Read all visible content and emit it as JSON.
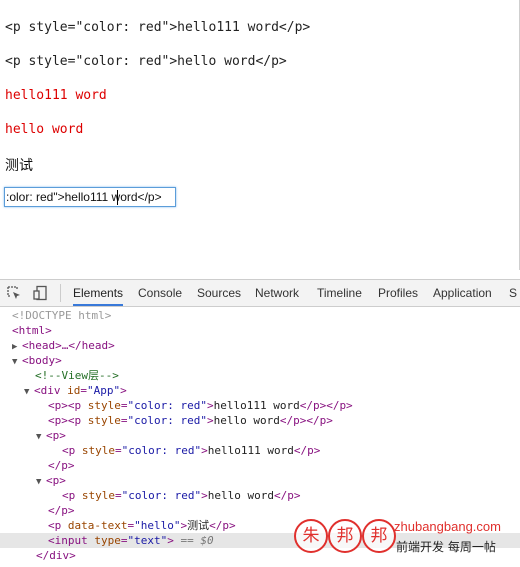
{
  "page": {
    "line1": "<p style=\"color: red\">hello111 word</p>",
    "line2": "<p style=\"color: red\">hello word</p>",
    "red1": "hello111 word",
    "red2": "hello word",
    "cn": "测试",
    "input_value": ":olor: red\">hello111 word</p>",
    "red_color": "#dd0000"
  },
  "devtools": {
    "tabs": [
      "Elements",
      "Console",
      "Sources",
      "Network",
      "Timeline",
      "Profiles",
      "Application",
      "S"
    ],
    "active_tab": "Elements",
    "icons": [
      "inspect-icon",
      "device-mode-icon"
    ],
    "tree": {
      "doctype": "<!DOCTYPE html>",
      "html_open": "<html>",
      "head": "<head>…</head>",
      "body_open": "<body>",
      "comment": "<!--View层-->",
      "div_open_tag": "<div",
      "div_attr": "id",
      "div_val": "\"App\"",
      "div_close_bracket": ">",
      "p1_open": "<p>",
      "p1_inner_tag": "<p",
      "style_attr": "style",
      "style_val": "\"color: red\"",
      "p1_text": "hello111 word",
      "p_close_pair": "</p></p>",
      "p2_text": "hello word",
      "p_open": "<p>",
      "p_inner_tag": "<p",
      "p_close": "</p>",
      "p_data_tag": "<p",
      "data_text_attr": "data-text",
      "data_text_val": "\"hello\"",
      "p_data_text": "测试",
      "input_tag": "<input",
      "type_attr": "type",
      "type_val": "\"text\"",
      "input_close": ">",
      "eq_dollar": "== $0",
      "div_close": "</div>"
    }
  },
  "watermark": {
    "chars": [
      "朱",
      "邦",
      "邦"
    ],
    "site": "zhubangbang.com",
    "slogan": "前端开发 每周一帖"
  }
}
